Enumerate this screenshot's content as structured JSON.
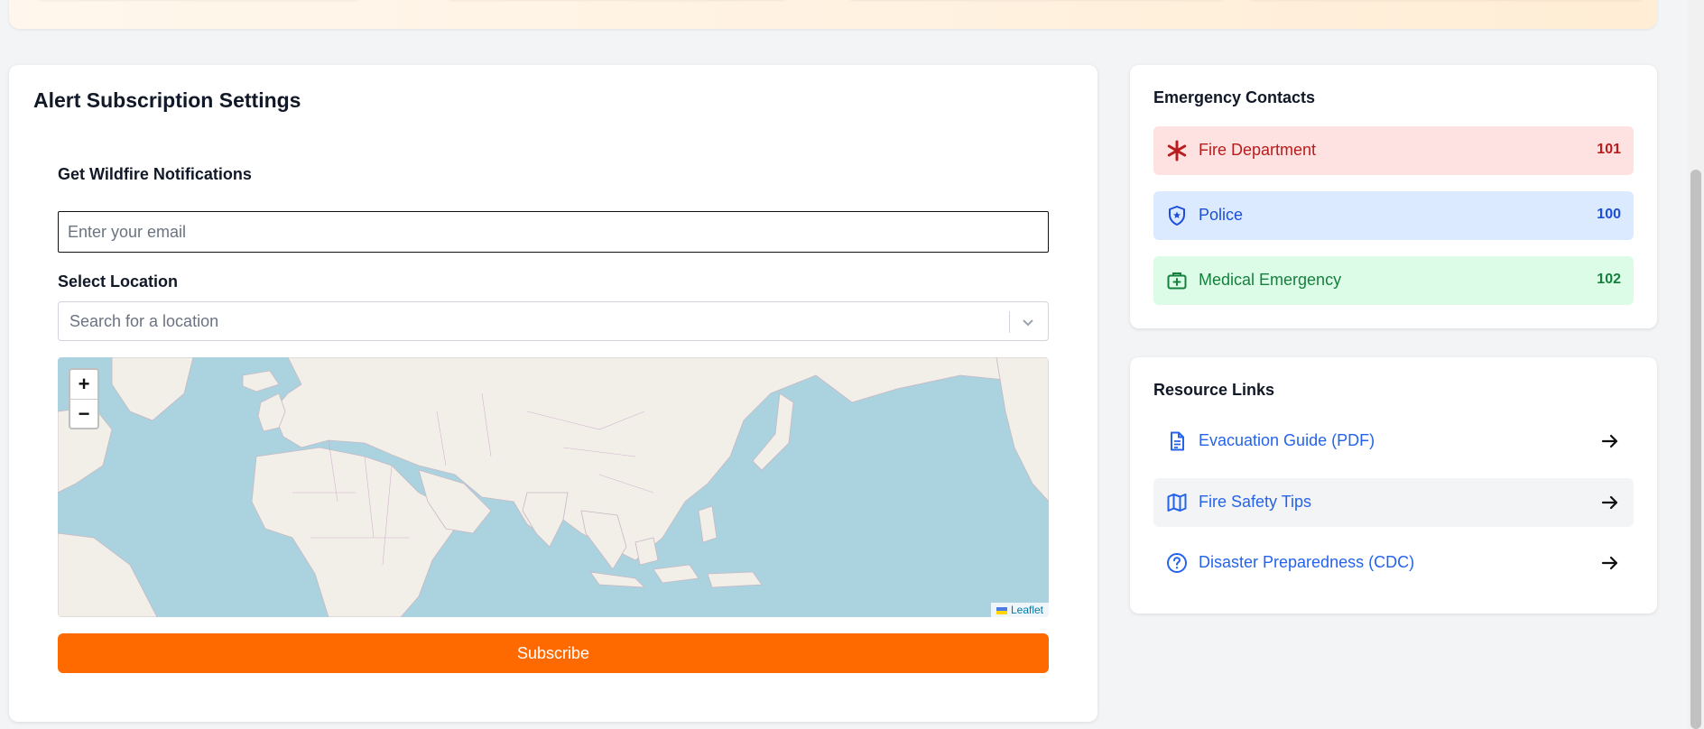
{
  "subscription": {
    "title": "Alert Subscription Settings",
    "notify_label": "Get Wildfire Notifications",
    "email_placeholder": "Enter your email",
    "location_label": "Select Location",
    "location_placeholder": "Search for a location",
    "subscribe_label": "Subscribe"
  },
  "map": {
    "zoom_in": "+",
    "zoom_out": "−",
    "attribution": "Leaflet",
    "water_color": "#aad3df",
    "land_color": "#f2efe9"
  },
  "contacts": {
    "title": "Emergency Contacts",
    "items": [
      {
        "name": "Fire Department",
        "number": "101",
        "icon": "asterisk-icon",
        "color": "#b91c1c"
      },
      {
        "name": "Police",
        "number": "100",
        "icon": "shield-icon",
        "color": "#1d4ed8"
      },
      {
        "name": "Medical Emergency",
        "number": "102",
        "icon": "medical-kit-icon",
        "color": "#15803d"
      }
    ]
  },
  "resources": {
    "title": "Resource Links",
    "items": [
      {
        "name": "Evacuation Guide (PDF)",
        "icon": "document-icon"
      },
      {
        "name": "Fire Safety Tips",
        "icon": "map-icon"
      },
      {
        "name": "Disaster Preparedness (CDC)",
        "icon": "help-circle-icon"
      }
    ]
  },
  "theme": {
    "accent": "#ff6a00"
  }
}
